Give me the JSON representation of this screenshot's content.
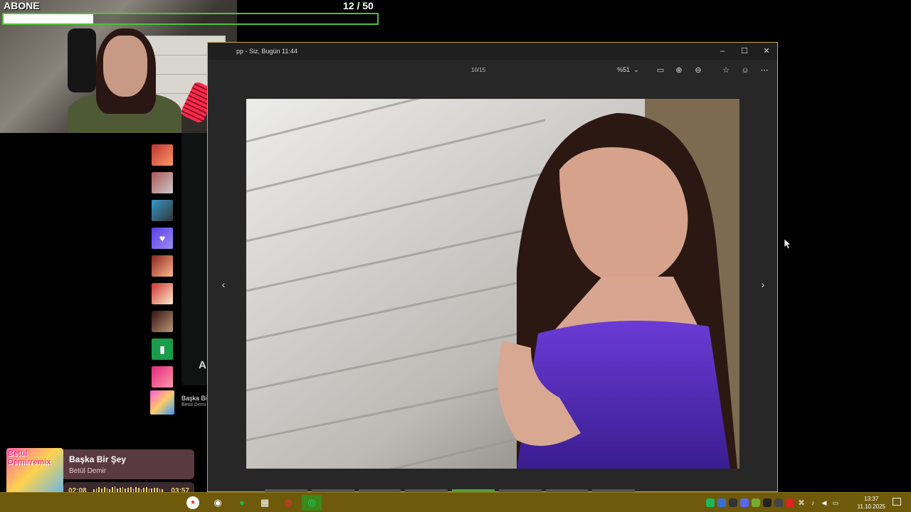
{
  "overlay": {
    "subscribe_label": "ABONE",
    "subscribe_current": "12",
    "subscribe_goal": "/ 50",
    "subscribe_progress": 0.24
  },
  "viewer": {
    "title": "pp - Siz, Bugün 11:44",
    "counter": "10/15",
    "zoom_level": "%51",
    "window_controls": [
      "minimize-icon",
      "maximize-icon",
      "close-icon"
    ],
    "toolbar_icons": [
      "fit-icon",
      "zoom-in-icon",
      "zoom-out-icon",
      "star-icon",
      "emoji-icon",
      "more-icon"
    ]
  },
  "music_app": {
    "partial_heading": "A",
    "now_playing_small_title": "Başka Bir",
    "now_playing_small_artist": "Betül Demi"
  },
  "now_playing": {
    "cover_text": "Betül Demirremix",
    "title": "Başka Bir Şey",
    "artist": "Betül Demir",
    "current_time": "02:08",
    "duration": "03:57",
    "progress": 0.54
  },
  "taskbar": {
    "time": "13:37",
    "date": "11.10.2025",
    "apps": [
      "chrome-icon",
      "steam-icon",
      "spotify-icon",
      "store-icon",
      "app-icon",
      "whatsapp-icon"
    ]
  },
  "colors": {
    "taskbar": "#6e5a0a",
    "accent_green": "#4ec23a",
    "spotify_green": "#1db954",
    "whatsapp_green": "#25d366",
    "now_playing_card": "#5a3a41",
    "time_yellow": "#f0d36b"
  }
}
